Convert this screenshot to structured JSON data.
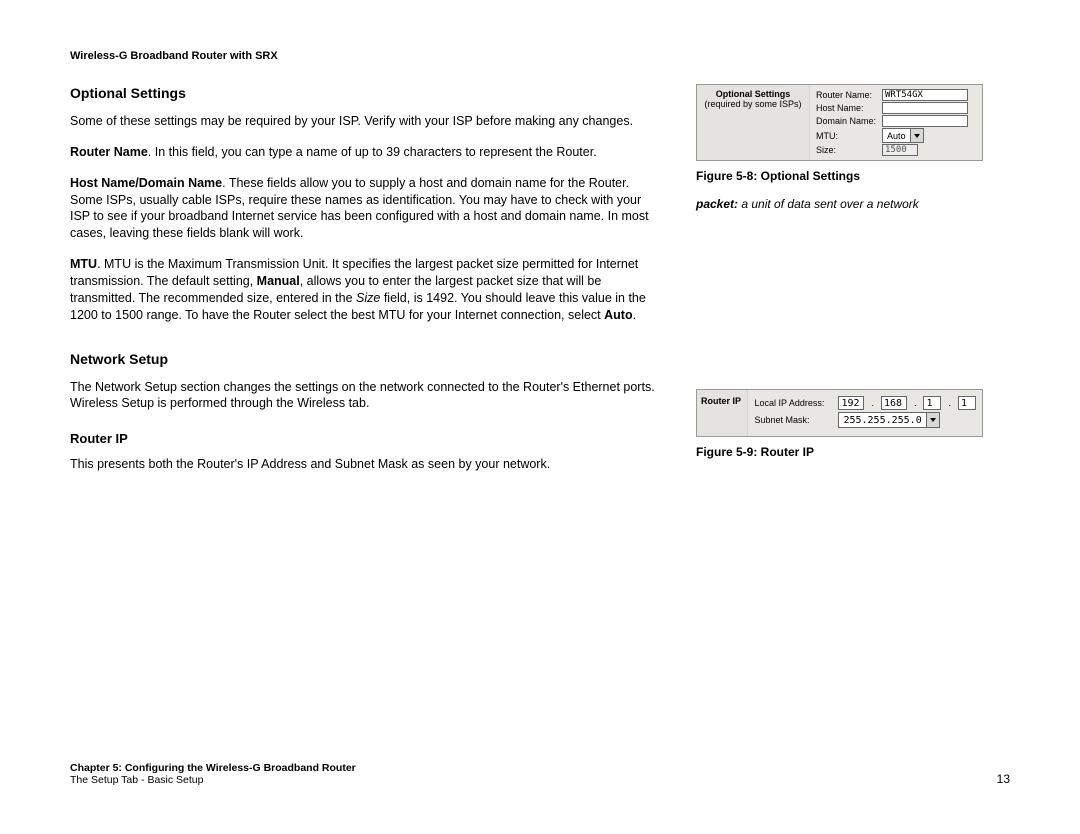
{
  "header": {
    "product": "Wireless-G Broadband Router with SRX"
  },
  "sections": {
    "optional": {
      "title": "Optional Settings",
      "intro": "Some of these settings may be required by your ISP. Verify with your ISP before making any changes.",
      "router_name_label": "Router Name",
      "router_name_text": ". In this field, you can type a name of up to 39 characters to represent the Router.",
      "host_domain_label": "Host Name/Domain Name",
      "host_domain_text": ". These fields allow you to supply a host and domain name for the Router. Some ISPs, usually cable ISPs, require these names as identification. You may have to check with your ISP to see if your broadband Internet service has been configured with a host and domain name. In most cases, leaving these fields blank will work.",
      "mtu_label": "MTU",
      "mtu_text_a": ". MTU is the Maximum Transmission Unit. It specifies the largest packet size permitted for Internet transmission. The default setting, ",
      "mtu_manual": "Manual",
      "mtu_text_b": ", allows you to enter the largest packet size that will be transmitted. The recommended size, entered in the ",
      "mtu_size_word": "Size",
      "mtu_text_c": " field, is 1492. You should leave this value in the 1200 to 1500 range. To have the Router select the best MTU for your Internet connection, select ",
      "mtu_auto": "Auto",
      "mtu_text_d": "."
    },
    "network": {
      "title": "Network Setup",
      "intro": "The Network Setup section changes the settings on the network connected to the Router's Ethernet ports. Wireless Setup is performed through the Wireless tab."
    },
    "routerip": {
      "title": "Router IP",
      "text": "This presents both the Router's IP Address and Subnet Mask as seen by your network."
    }
  },
  "fig58": {
    "panel_title1": "Optional Settings",
    "panel_title2": "(required by some ISPs)",
    "labels": {
      "router_name": "Router Name:",
      "host_name": "Host Name:",
      "domain_name": "Domain Name:",
      "mtu": "MTU:",
      "size": "Size:"
    },
    "values": {
      "router_name": "WRT54GX",
      "host_name": "",
      "domain_name": "",
      "mtu": "Auto",
      "size": "1500"
    },
    "caption": "Figure 5-8: Optional Settings"
  },
  "glossary": {
    "term": "packet:",
    "def": " a unit of data sent over a network"
  },
  "fig59": {
    "panel_title": "Router IP",
    "labels": {
      "local_ip": "Local IP Address:",
      "subnet": "Subnet Mask:"
    },
    "ip": [
      "192",
      "168",
      "1",
      "1"
    ],
    "subnet": "255.255.255.0",
    "caption": "Figure 5-9: Router IP"
  },
  "footer": {
    "line1": "Chapter 5: Configuring the Wireless-G Broadband Router",
    "line2": "The Setup Tab - Basic Setup",
    "page": "13"
  }
}
